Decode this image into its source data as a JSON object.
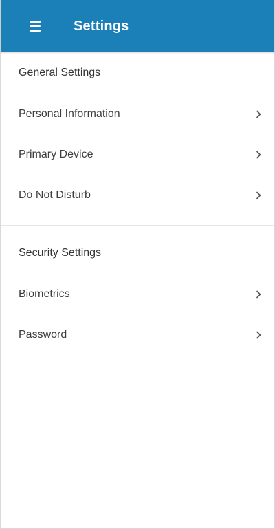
{
  "appbar": {
    "title": "Settings",
    "background": "#1b7fb8",
    "menu_icon": "hamburger-icon"
  },
  "general": {
    "header": "General Settings",
    "items": [
      {
        "label": "Personal Information",
        "icon": "chevron-right-icon"
      },
      {
        "label": "Primary Device",
        "icon": "chevron-right-icon"
      },
      {
        "label": "Do Not Disturb",
        "icon": "chevron-right-icon"
      }
    ]
  },
  "security": {
    "header": "Security Settings",
    "items": [
      {
        "label": "Biometrics",
        "icon": "chevron-right-icon"
      },
      {
        "label": "Password",
        "icon": "chevron-right-icon"
      }
    ]
  }
}
